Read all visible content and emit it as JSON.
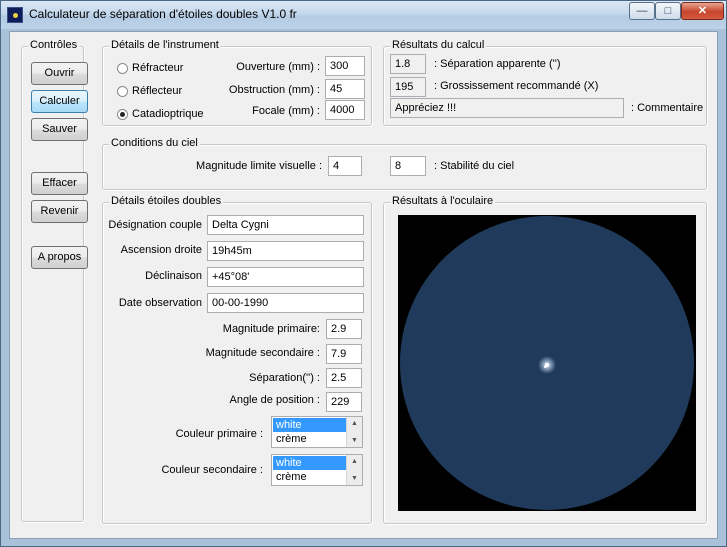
{
  "window": {
    "title": "Calculateur de séparation d'étoiles doubles V1.0 fr",
    "controls": {
      "minimize": "—",
      "maximize": "□",
      "close": "✕"
    }
  },
  "controles": {
    "title": "Contrôles",
    "buttons": [
      "Ouvrir",
      "Calculer",
      "Sauver",
      "Effacer",
      "Revenir",
      "A propos"
    ]
  },
  "instrument": {
    "title": "Détails de l'instrument",
    "types": [
      {
        "label": "Réfracteur",
        "selected": false
      },
      {
        "label": "Réflecteur",
        "selected": false
      },
      {
        "label": "Catadioptrique",
        "selected": true
      }
    ],
    "fields": [
      {
        "label": "Ouverture (mm) :",
        "value": "300"
      },
      {
        "label": "Obstruction (mm) :",
        "value": "45"
      },
      {
        "label": "Focale (mm) :",
        "value": "4000"
      }
    ]
  },
  "resultats": {
    "title": "Résultats du calcul",
    "separation_value": "1.8",
    "separation_label": ": Séparation apparente ('')",
    "grossissement_value": "195",
    "grossissement_label": ": Grossissement recommandé (X)",
    "commentaire_value": "Appréciez !!!",
    "commentaire_label": ": Commentaire"
  },
  "ciel": {
    "title": "Conditions du ciel",
    "magnitude_label": "Magnitude limite visuelle :",
    "magnitude_value": "4",
    "stabilite_value": "8",
    "stabilite_label": ": Stabilité du ciel"
  },
  "etoiles": {
    "title": "Détails étoiles doubles",
    "designation_label": "Désignation couple",
    "designation_value": "Delta Cygni",
    "ascension_label": "Ascension droite",
    "ascension_value": "19h45m",
    "declinaison_label": "Déclinaison",
    "declinaison_value": "+45°08'",
    "date_label": "Date observation",
    "date_value": "00-00-1990",
    "mag_primaire_label": "Magnitude primaire:",
    "mag_primaire_value": "2.9",
    "mag_secondaire_label": "Magnitude secondaire :",
    "mag_secondaire_value": "7.9",
    "separation_label": "Séparation('') :",
    "separation_value": "2.5",
    "angle_label": "Angle de position :",
    "angle_value": "229",
    "couleur_primaire_label": "Couleur primaire :",
    "couleur_primaire_options": [
      "white",
      "crème"
    ],
    "couleur_secondaire_label": "Couleur secondaire :",
    "couleur_secondaire_options": [
      "white",
      "crème"
    ],
    "selected_color": "white"
  },
  "oculaire": {
    "title": "Résultats à l'oculaire",
    "field_color": "#1f3a5a",
    "star_color": "#ffffff"
  }
}
